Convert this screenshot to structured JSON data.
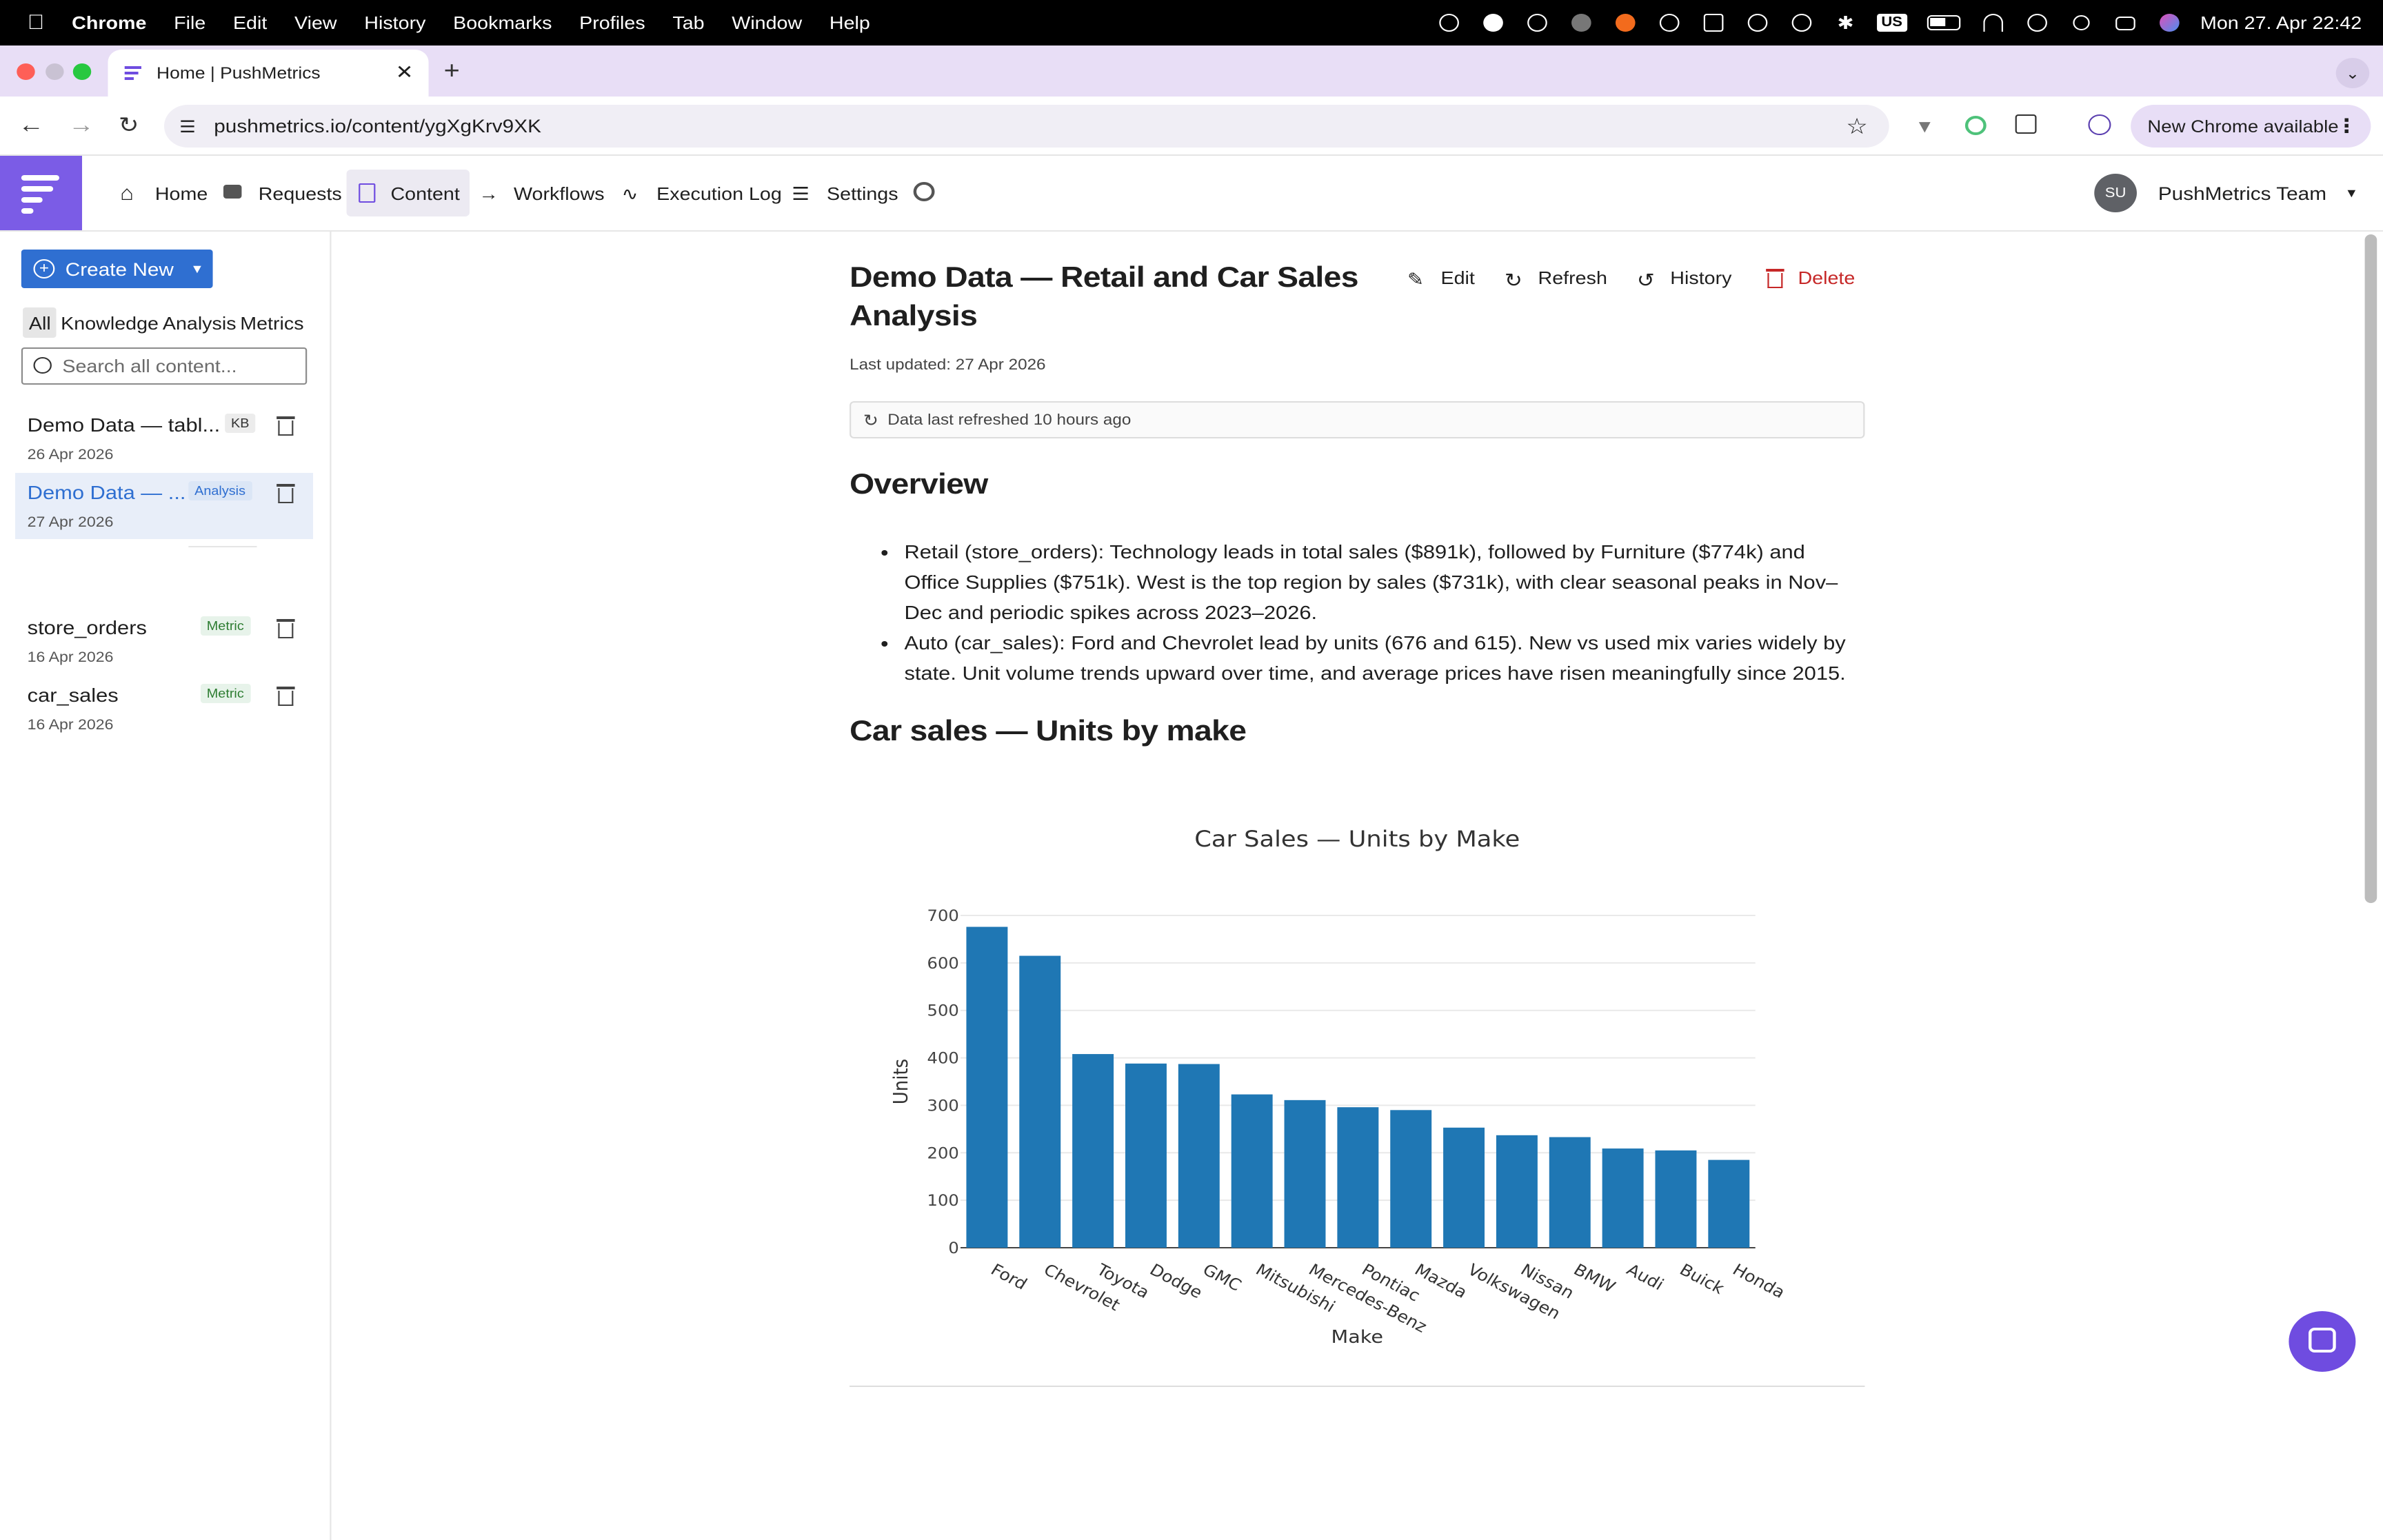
{
  "menubar": {
    "app": "Chrome",
    "items": [
      "File",
      "Edit",
      "View",
      "History",
      "Bookmarks",
      "Profiles",
      "Tab",
      "Window",
      "Help"
    ],
    "input_source": "US",
    "clock": "Mon 27. Apr  22:42"
  },
  "browser": {
    "tab_title": "Home | PushMetrics",
    "url": "pushmetrics.io/content/ygXgKrv9XK",
    "new_chrome": "New Chrome available"
  },
  "app": {
    "nav": [
      "Home",
      "Requests",
      "Content",
      "Workflows",
      "Execution Log",
      "Settings"
    ],
    "active_nav": "Content",
    "user_initials": "SU",
    "user_name": "PushMetrics Team"
  },
  "sidebar": {
    "create_label": "Create New",
    "filters": [
      "All",
      "Knowledge",
      "Analysis",
      "Metrics"
    ],
    "search_placeholder": "Search all content...",
    "items": [
      {
        "name": "Demo Data — tabl...",
        "badge": "KB",
        "date": "26 Apr 2026"
      },
      {
        "name": "Demo Data — ...",
        "badge": "Analysis",
        "date": "27 Apr 2026"
      },
      {
        "name": "store_orders",
        "badge": "Metric",
        "date": "16 Apr 2026"
      },
      {
        "name": "car_sales",
        "badge": "Metric",
        "date": "16 Apr 2026"
      }
    ]
  },
  "doc": {
    "title": "Demo Data — Retail and Car Sales Analysis",
    "actions": {
      "edit": "Edit",
      "refresh": "Refresh",
      "history": "History",
      "delete": "Delete"
    },
    "last_updated": "Last updated: 27 Apr 2026",
    "refreshed": "Data last refreshed 10 hours ago",
    "overview_heading": "Overview",
    "bullets": [
      "Retail (store_orders): Technology leads in total sales ($891k), followed by Furniture ($774k) and Office Supplies ($751k). West is the top region by sales ($731k), with clear seasonal peaks in Nov–Dec and periodic spikes across 2023–2026.",
      "Auto (car_sales): Ford and Chevrolet lead by units (676 and 615). New vs used mix varies widely by state. Unit volume trends upward over time, and average prices have risen meaningfully since 2015."
    ],
    "chart_heading": "Car sales — Units by make"
  },
  "chart_data": {
    "type": "bar",
    "title": "Car Sales — Units by Make",
    "xlabel": "Make",
    "ylabel": "Units",
    "ylim": [
      0,
      700
    ],
    "yticks": [
      0,
      100,
      200,
      300,
      400,
      500,
      600,
      700
    ],
    "categories": [
      "Ford",
      "Chevrolet",
      "Toyota",
      "Dodge",
      "GMC",
      "Mitsubishi",
      "Mercedes-Benz",
      "Pontiac",
      "Mazda",
      "Volkswagen",
      "Nissan",
      "BMW",
      "Audi",
      "Buick",
      "Honda"
    ],
    "values": [
      676,
      615,
      408,
      388,
      387,
      323,
      311,
      296,
      290,
      253,
      237,
      233,
      209,
      205,
      185
    ],
    "bar_color": "#1f77b4",
    "grid": true
  },
  "colors": {
    "accent": "#7b5ce6",
    "primary_button": "#2f6fd1",
    "delete": "#c62828"
  }
}
